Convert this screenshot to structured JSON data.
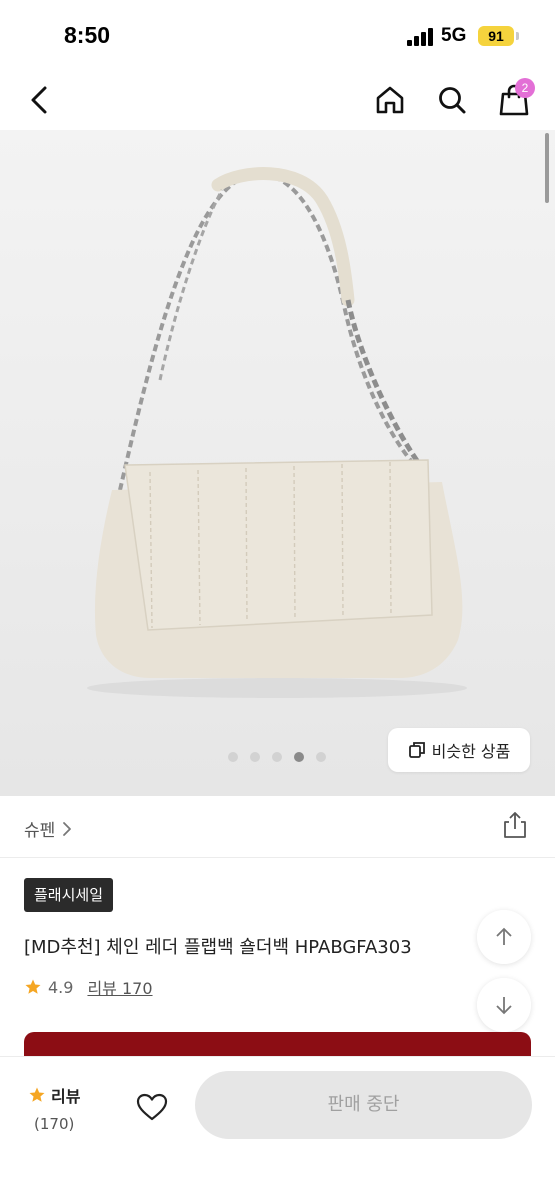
{
  "status_bar": {
    "time": "8:50",
    "network": "5G",
    "battery": "91"
  },
  "nav": {
    "back_icon": "chevron-left-icon",
    "home_icon": "home-icon",
    "search_icon": "search-icon",
    "cart_icon": "shopping-bag-icon",
    "cart_count": "2",
    "badge_color": "#e36fd6"
  },
  "gallery": {
    "image": "cream-quilted-chain-shoulder-bag",
    "dot_count": 5,
    "active_dot": 4,
    "similar_button_label": "비슷한 상품",
    "similar_icon": "copy-icon"
  },
  "brand": {
    "name": "슈펜",
    "share_icon": "share-icon"
  },
  "product": {
    "badge": "플래시세일",
    "title": "[MD추천] 체인 레더 플랩백 숄더백 HPABGFA303",
    "rating": "4.9",
    "review_link": "리뷰 170",
    "star_color": "#f5a623"
  },
  "scroll_buttons": {
    "up_icon": "arrow-up-icon",
    "down_icon": "arrow-down-icon"
  },
  "promo": {
    "color": "#8c0d14"
  },
  "bottom_bar": {
    "review_label": "리뷰",
    "review_count": "(170)",
    "wish_icon": "heart-icon",
    "action_label": "판매 중단"
  }
}
